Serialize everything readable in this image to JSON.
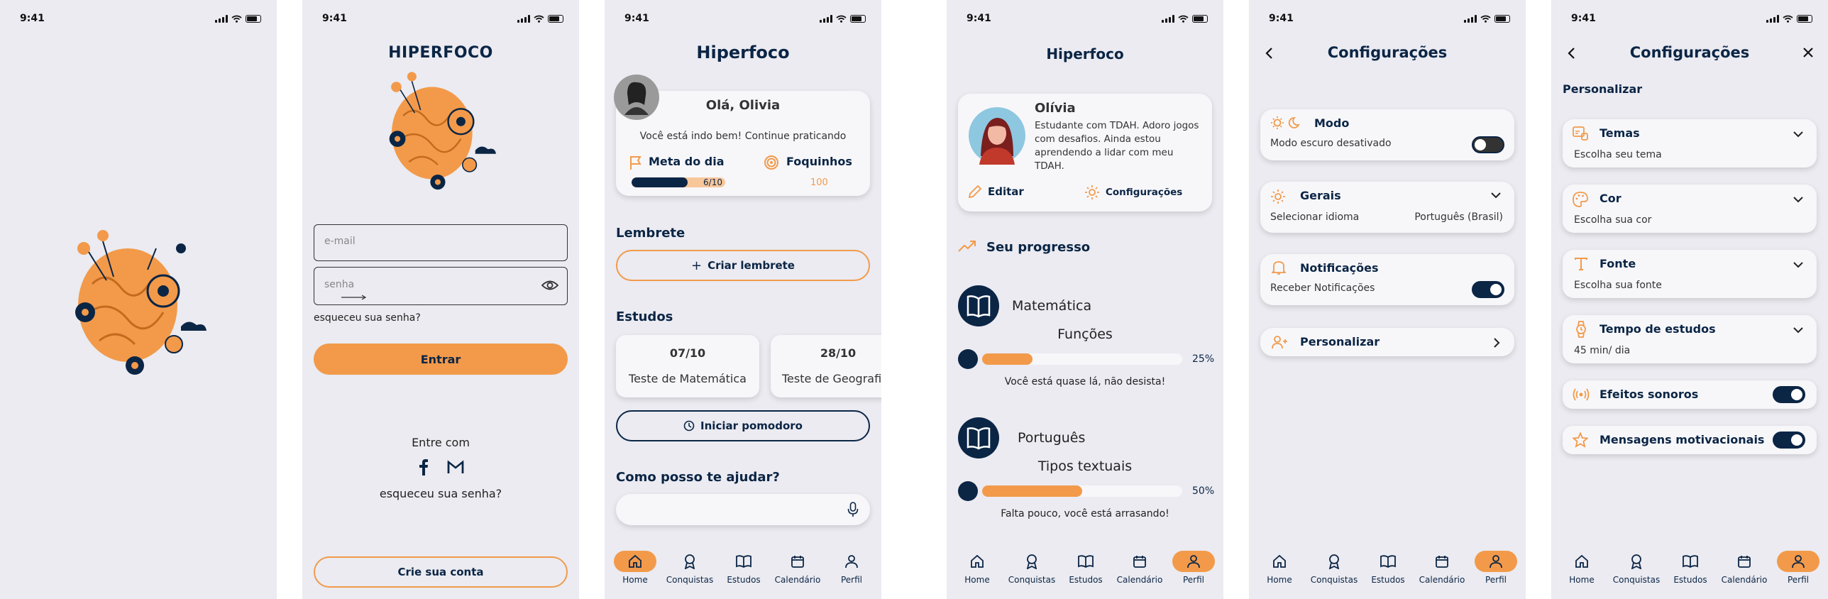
{
  "status_time": "9:41",
  "screen2": {
    "brand": "HIPERFOCO",
    "email_placeholder": "e-mail",
    "password_placeholder": "senha",
    "forgot": "esqueceu sua senha?",
    "enter": "Entrar",
    "login_with": "Entre com",
    "forgot2": "esqueceu sua senha?",
    "create": "Crie sua conta"
  },
  "screen3": {
    "title": "Hiperfoco",
    "greeting": "Olá, Olivia",
    "motivation": "Você está indo bem! Continue praticando",
    "goal_label": "Meta do dia",
    "goal_value": "6/10",
    "goal_progress": 0.6,
    "fire_label": "Foquinhos",
    "fire_value": "100",
    "reminder_heading": "Lembrete",
    "reminder_button": "Criar lembrete",
    "studies_heading": "Estudos",
    "studies": [
      {
        "date": "07/10",
        "name": "Teste de Matemática"
      },
      {
        "date": "28/10",
        "name": "Teste de Geografia"
      }
    ],
    "pomodoro": "Iniciar pomodoro",
    "help_heading": "Como posso te ajudar?"
  },
  "screen4": {
    "title": "Hiperfoco",
    "name": "Olívia",
    "bio": "Estudante com TDAH. Adoro jogos com desafios. Ainda estou aprendendo a lidar com meu TDAH.",
    "edit": "Editar",
    "settings": "Configurações",
    "progress_heading": "Seu progresso",
    "subjects": [
      {
        "subject": "Matemática",
        "topic": "Funções",
        "percent": "25%",
        "progress": 0.25,
        "message": "Você está quase lá, não desista!"
      },
      {
        "subject": "Português",
        "topic": "Tipos textuais",
        "percent": "50%",
        "progress": 0.5,
        "message": "Falta pouco, você está arrasando!"
      }
    ]
  },
  "screen5": {
    "title": "Configurações",
    "mode_label": "Modo",
    "mode_sub": "Modo escuro desativado",
    "general_label": "Gerais",
    "general_sub": "Selecionar idioma",
    "general_value": "Português (Brasil)",
    "notif_label": "Notificações",
    "notif_sub": "Receber Notificações",
    "personalize_label": "Personalizar"
  },
  "screen6": {
    "title": "Configurações",
    "section": "Personalizar",
    "items": [
      {
        "label": "Temas",
        "sub": "Escolha seu tema"
      },
      {
        "label": "Cor",
        "sub": "Escolha sua cor"
      },
      {
        "label": "Fonte",
        "sub": "Escolha sua fonte"
      },
      {
        "label": "Tempo de estudos",
        "sub": "45 min/ dia"
      }
    ],
    "sound_label": "Efeitos sonoros",
    "motivation_label": "Mensagens motivacionais"
  },
  "nav": [
    "Home",
    "Conquistas",
    "Estudos",
    "Calendário",
    "Perfil"
  ],
  "colors": {
    "accent": "#f29a4a",
    "navy": "#0b2545",
    "background": "#ebebf1",
    "card": "#f7f7fa"
  }
}
